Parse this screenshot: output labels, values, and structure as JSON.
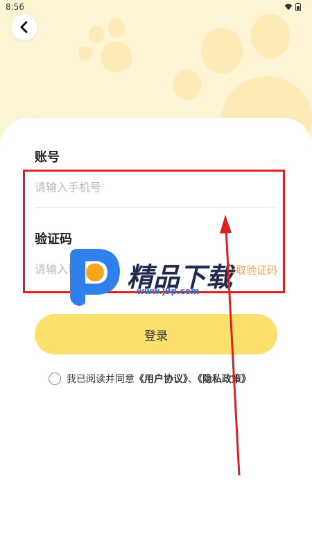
{
  "status_bar": {
    "time": "8:56"
  },
  "form": {
    "phone_label": "账号",
    "phone_placeholder": "请输入手机号",
    "code_label": "验证码",
    "code_placeholder": "请输入验证码",
    "get_code_label": "获取验证码"
  },
  "login_button": "登录",
  "agreement": {
    "prefix": "我已阅读并同意",
    "user_agreement": "《用户协议》",
    "separator": "、",
    "privacy_policy": "《隐私政策》"
  },
  "watermark": {
    "brand": "精品下载",
    "url": "www.j9p.com"
  },
  "colors": {
    "accent": "#fbe06d",
    "background_top": "#fdf4d3",
    "get_code": "#f5a04a",
    "annotation_red": "#e02020"
  }
}
